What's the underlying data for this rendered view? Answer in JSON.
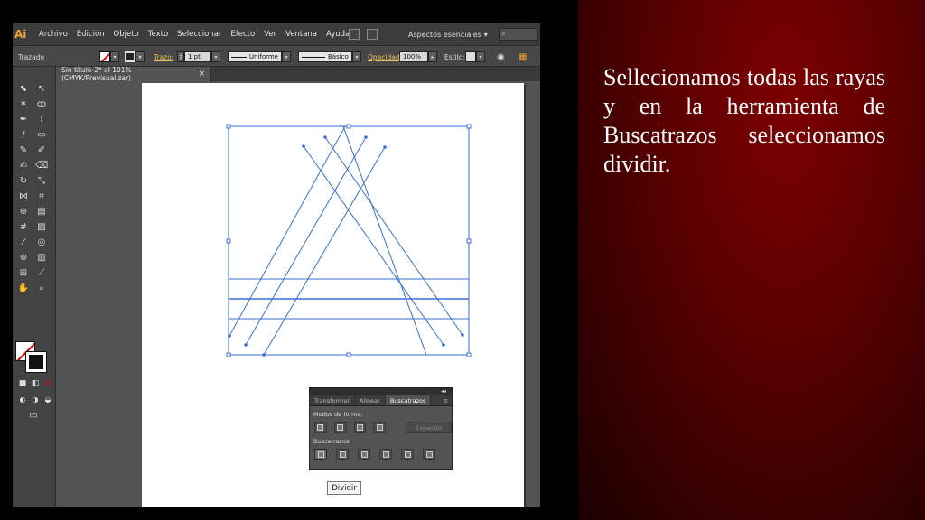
{
  "app": {
    "logo": "Ai",
    "menu": [
      "Archivo",
      "Edición",
      "Objeto",
      "Texto",
      "Seleccionar",
      "Efecto",
      "Ver",
      "Ventana",
      "Ayuda"
    ],
    "workspace_label": "Aspectos esenciales",
    "search_icon": "search-icon"
  },
  "control_bar": {
    "selection_label": "Trazado",
    "stroke_label": "Trazo:",
    "stroke_weight": "1 pt",
    "profile_label": "Uniforme",
    "brush_label": "Básico",
    "opacity_label": "Opacidad:",
    "opacity_value": "100%",
    "style_label": "Estilo:"
  },
  "document": {
    "tab_title": "Sin título-2* al 101% (CMYK/Previsualizar)",
    "tab_close": "×"
  },
  "pathfinder_panel": {
    "collapse_glyph": "◂◂",
    "tabs": [
      "Transformar",
      "Alinear",
      "Buscatrazos"
    ],
    "active_tab": "Buscatrazos",
    "shape_modes_label": "Modos de forma:",
    "expand_label": "Expandir",
    "pathfinders_label": "Buscatrazos:"
  },
  "tooltip": {
    "text": "Dividir"
  },
  "slide": {
    "text": "Sellecionamos todas las rayas y en la herramienta de Buscatrazos seleccionamos dividir."
  },
  "colors": {
    "slide_background": "#5a0000",
    "selection_blue": "#3b6fd6"
  }
}
